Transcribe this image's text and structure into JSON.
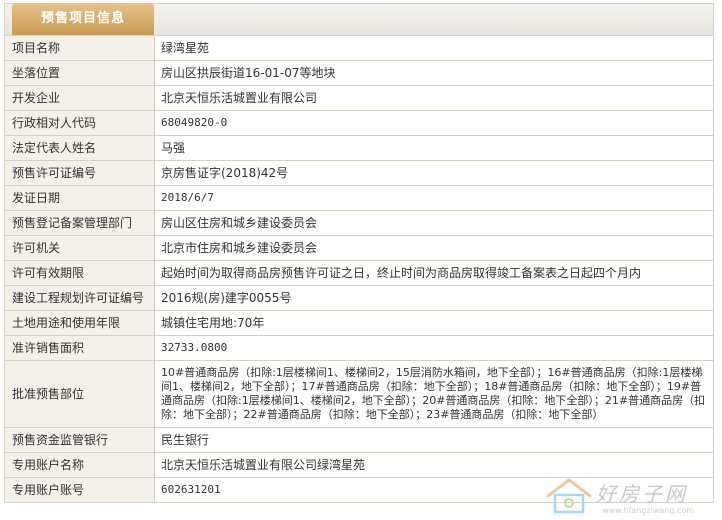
{
  "tab": {
    "title": "预售项目信息"
  },
  "rows": [
    {
      "label": "项目名称",
      "value": "绿湾星苑"
    },
    {
      "label": "坐落位置",
      "value": "房山区拱辰街道16-01-07等地块"
    },
    {
      "label": "开发企业",
      "value": "北京天恒乐活城置业有限公司"
    },
    {
      "label": "行政相对人代码",
      "value": "68049820-0"
    },
    {
      "label": "法定代表人姓名",
      "value": "马强"
    },
    {
      "label": "预售许可证编号",
      "value": "京房售证字(2018)42号"
    },
    {
      "label": "发证日期",
      "value": "2018/6/7"
    },
    {
      "label": "预售登记备案管理部门",
      "value": "房山区住房和城乡建设委员会"
    },
    {
      "label": "许可机关",
      "value": "北京市住房和城乡建设委员会"
    },
    {
      "label": "许可有效期限",
      "value": "起始时间为取得商品房预售许可证之日，终止时间为商品房取得竣工备案表之日起四个月内"
    },
    {
      "label": "建设工程规划许可证编号",
      "value": "2016规(房)建字0055号"
    },
    {
      "label": "土地用途和使用年限",
      "value": "城镇住宅用地:70年"
    },
    {
      "label": "准许销售面积",
      "value": "32733.0800"
    },
    {
      "label": "批准预售部位",
      "value": "10#普通商品房（扣除:1层楼梯间1、楼梯间2，15层消防水箱间，地下全部）；16#普通商品房（扣除:1层楼梯间1、楼梯间2，地下全部）；17#普通商品房（扣除：地下全部）；18#普通商品房（扣除：地下全部）；19#普通商品房（扣除:1层楼梯间1、楼梯间2，地下全部）；20#普通商品房（扣除：地下全部）；21#普通商品房（扣除：地下全部）；22#普通商品房（扣除：地下全部）；23#普通商品房（扣除：地下全部）"
    },
    {
      "label": "预售资金监管银行",
      "value": "民生银行"
    },
    {
      "label": "专用账户名称",
      "value": "北京天恒乐活城置业有限公司绿湾星苑"
    },
    {
      "label": "专用账户账号",
      "value": "602631201"
    }
  ],
  "watermark": {
    "text": "好房子网",
    "url": "www.hfangziwang.com"
  },
  "colors": {
    "tab": "#c99a55",
    "label_bg": "#f3f1e9",
    "border": "#d6d2c4"
  }
}
